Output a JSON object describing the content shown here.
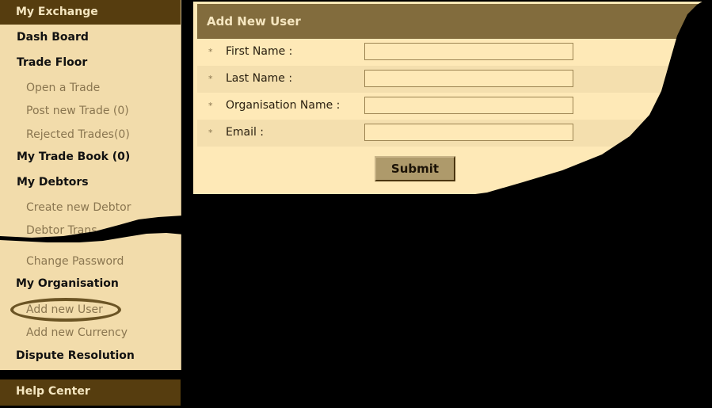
{
  "sidebar": {
    "header": "My Exchange",
    "items": [
      {
        "label": "Dash Board",
        "type": "main"
      },
      {
        "label": "Trade Floor",
        "type": "main"
      },
      {
        "label": "Open a Trade",
        "type": "sub"
      },
      {
        "label": "Post new Trade (0)",
        "type": "sub"
      },
      {
        "label": "Rejected Trades(0)",
        "type": "sub"
      },
      {
        "label": "My Trade Book (0)",
        "type": "main"
      },
      {
        "label": "My Debtors",
        "type": "main"
      },
      {
        "label": "Create new Debtor",
        "type": "sub"
      },
      {
        "label": "Debtor Trans",
        "type": "sub"
      },
      {
        "label": "Change Password",
        "type": "sub"
      },
      {
        "label": "My Organisation",
        "type": "main"
      },
      {
        "label": "Add new User",
        "type": "sub",
        "highlighted": true
      },
      {
        "label": "Add new Currency",
        "type": "sub"
      },
      {
        "label": "Dispute Resolution",
        "type": "main"
      }
    ],
    "help_header": "Help Center"
  },
  "form": {
    "title": "Add New User",
    "required_marker": "*",
    "fields": [
      {
        "label": "First Name :",
        "value": ""
      },
      {
        "label": "Last Name :",
        "value": ""
      },
      {
        "label": "Organisation Name :",
        "value": ""
      },
      {
        "label": "Email :",
        "value": ""
      }
    ],
    "submit_label": "Submit"
  },
  "colors": {
    "header_dark": "#563d0f",
    "panel_title": "#826c3d",
    "sidebar_bg": "#f2dcab",
    "panel_bg": "#fee9b7",
    "highlight": "#6b5424"
  }
}
